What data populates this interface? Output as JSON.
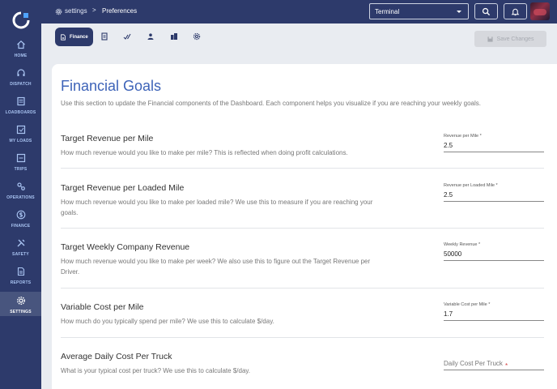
{
  "sidebar": {
    "items": [
      {
        "label": "HOME",
        "icon": "home-icon"
      },
      {
        "label": "DISPATCH",
        "icon": "headset-icon"
      },
      {
        "label": "LOADBOARDS",
        "icon": "list-board-icon"
      },
      {
        "label": "MY LOADS",
        "icon": "loads-icon"
      },
      {
        "label": "TRIPS",
        "icon": "trips-icon"
      },
      {
        "label": "OPERATIONS",
        "icon": "operations-icon"
      },
      {
        "label": "FINANCE",
        "icon": "dollar-icon"
      },
      {
        "label": "SAFETY",
        "icon": "tools-icon"
      },
      {
        "label": "REPORTS",
        "icon": "report-icon"
      },
      {
        "label": "SETTINGS",
        "icon": "gear-icon"
      }
    ],
    "active": "SETTINGS"
  },
  "topbar": {
    "breadcrumb_root": "settings",
    "breadcrumb_sep": ">",
    "breadcrumb_current": "Preferences",
    "terminal_value": "Terminal"
  },
  "tabs": {
    "active_label": "Finance",
    "icons": [
      "document-icon",
      "checklist-icon",
      "user-icon",
      "building-icon",
      "gear-icon"
    ]
  },
  "save_button": {
    "label": "Save Changes",
    "disabled": true
  },
  "card": {
    "title": "Financial Goals",
    "description": "Use this section to update the Financial components of the Dashboard. Each component helps you visualize if you are reaching your weekly goals."
  },
  "sections": [
    {
      "title": "Target Revenue per Mile",
      "description": "How much revenue would you like to make per mile? This is reflected when doing profit calculations.",
      "field_label": "Revenue per Mile *",
      "value": "2.5"
    },
    {
      "title": "Target Revenue per Loaded Mile",
      "description": "How much revenue would you like to make per loaded mile? We use this to measure if you are reaching your goals.",
      "field_label": "Revenue per Loaded Mile *",
      "value": "2.5"
    },
    {
      "title": "Target Weekly Company Revenue",
      "description": "How much revenue would you like to make per week? We also use this to figure out the Target Revenue per Driver.",
      "field_label": "Weekly Revenue *",
      "value": "50000"
    },
    {
      "title": "Variable Cost per Mile",
      "description": "How much do you typically spend per mile? We use this to calculate $/day.",
      "field_label": "Variable Cost per Mile *",
      "value": "1.7"
    },
    {
      "title": "Average Daily Cost Per Truck",
      "description": "What is your typical cost per truck? We use this to calculate $/day.",
      "placeholder": "Daily Cost Per Truck",
      "required_mark": "*"
    }
  ],
  "colors": {
    "nav_bg": "#2d3a6b",
    "accent": "#3d63b8",
    "page_bg": "#e9ecf1"
  }
}
